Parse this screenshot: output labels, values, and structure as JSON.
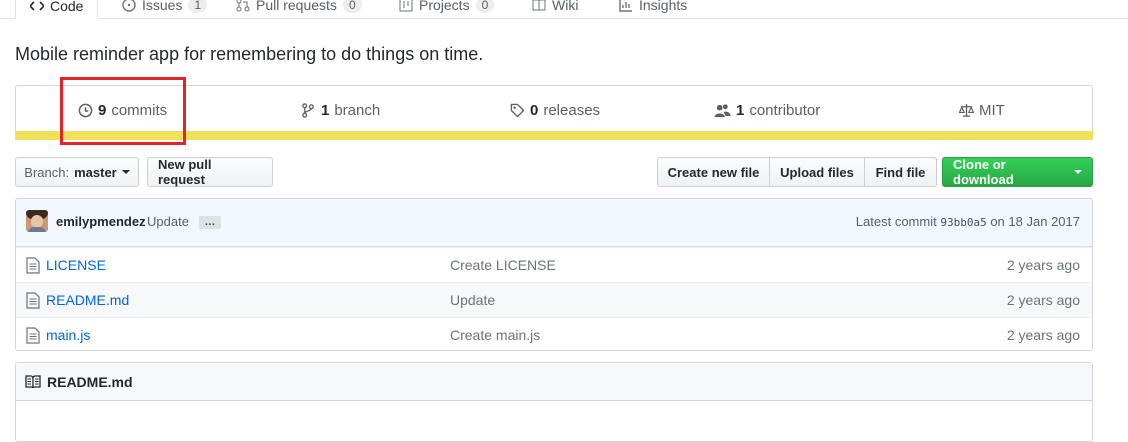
{
  "tabs": [
    {
      "label": "Code",
      "icon": "code-icon",
      "count": null,
      "selected": true
    },
    {
      "label": "Issues",
      "icon": "issue-icon",
      "count": "1",
      "selected": false
    },
    {
      "label": "Pull requests",
      "icon": "pull-request-icon",
      "count": "0",
      "selected": false
    },
    {
      "label": "Projects",
      "icon": "project-icon",
      "count": "0",
      "selected": false
    },
    {
      "label": "Wiki",
      "icon": "book-icon",
      "count": null,
      "selected": false
    },
    {
      "label": "Insights",
      "icon": "graph-icon",
      "count": null,
      "selected": false
    }
  ],
  "description": "Mobile reminder app for remembering to do things on time.",
  "summary": {
    "commits": {
      "num": "9",
      "label": "commits"
    },
    "branches": {
      "num": "1",
      "label": "branch"
    },
    "releases": {
      "num": "0",
      "label": "releases"
    },
    "contributors": {
      "num": "1",
      "label": "contributor"
    },
    "license": {
      "label": "MIT"
    },
    "language_color": "#f1e05a"
  },
  "toolbar": {
    "branch_prefix": "Branch:",
    "branch_name": "master",
    "new_pull_request": "New pull request",
    "create_new_file": "Create new file",
    "upload_files": "Upload files",
    "find_file": "Find file",
    "clone_or_download": "Clone or download"
  },
  "commit": {
    "author": "emilypmendez",
    "message": "Update",
    "ellipsis": "…",
    "latest_label": "Latest commit",
    "sha": "93bb0a5",
    "date_prefix": "on",
    "date": "18 Jan 2017"
  },
  "files": [
    {
      "name": "LICENSE",
      "message": "Create LICENSE",
      "age": "2 years ago"
    },
    {
      "name": "README.md",
      "message": "Update",
      "age": "2 years ago"
    },
    {
      "name": "main.js",
      "message": "Create main.js",
      "age": "2 years ago"
    }
  ],
  "readme": {
    "title": "README.md"
  },
  "colors": {
    "accent_tab": "#e36209",
    "link": "#0366d6",
    "green": "#28a745",
    "highlight_box": "#e32329"
  }
}
